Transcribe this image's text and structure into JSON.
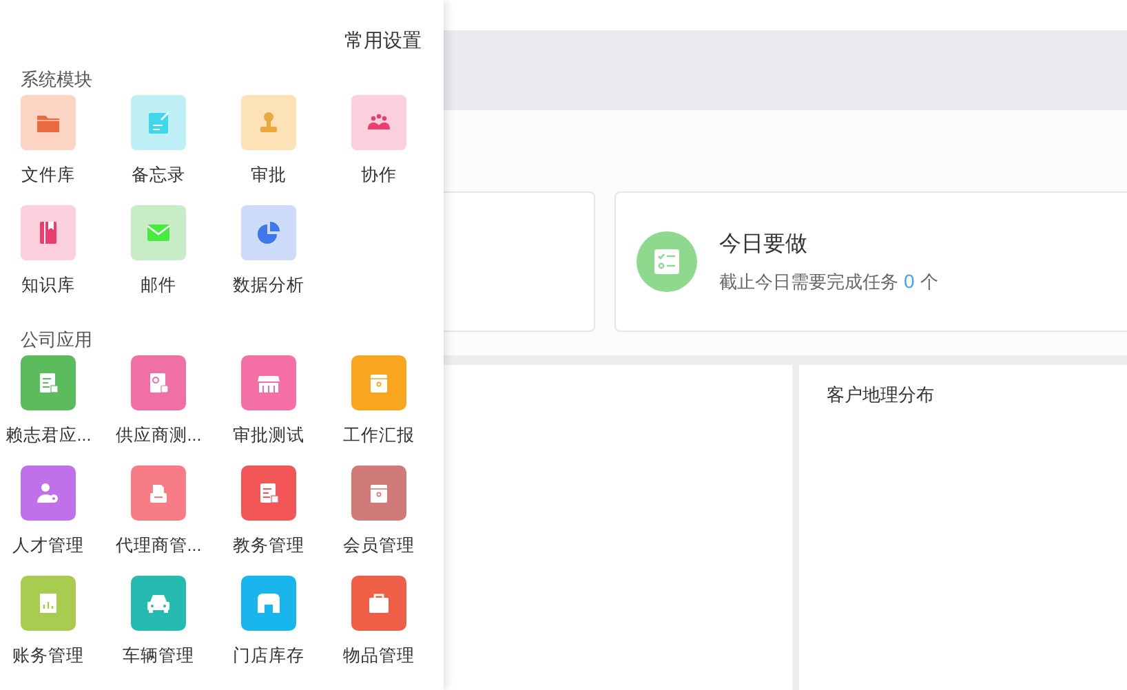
{
  "settings_link": "常用设置",
  "sections": [
    {
      "title": "系统模块",
      "apps": [
        {
          "label": "文件库",
          "kind": "folder",
          "color": "#fdd3c4"
        },
        {
          "label": "备忘录",
          "kind": "note",
          "color": "#bdeff5"
        },
        {
          "label": "审批",
          "kind": "stamp",
          "color": "#fde2b8"
        },
        {
          "label": "协作",
          "kind": "team",
          "color": "#fbd0dc"
        },
        {
          "label": "知识库",
          "kind": "book",
          "color": "#fbd0dc"
        },
        {
          "label": "邮件",
          "kind": "mail",
          "color": "#c8edc6"
        },
        {
          "label": "数据分析",
          "kind": "pie",
          "color": "#cddcfb"
        }
      ]
    },
    {
      "title": "公司应用",
      "apps": [
        {
          "label": "赖志君应...",
          "kind": "form",
          "color": "#5cbb5c"
        },
        {
          "label": "供应商测...",
          "kind": "gear-doc",
          "color": "#f06fa5"
        },
        {
          "label": "审批测试",
          "kind": "store",
          "color": "#f46fa5"
        },
        {
          "label": "工作汇报",
          "kind": "box",
          "color": "#f8a51f"
        },
        {
          "label": "人才管理",
          "kind": "user-gear",
          "color": "#c070e8"
        },
        {
          "label": "代理商管...",
          "kind": "printer",
          "color": "#f77c86"
        },
        {
          "label": "教务管理",
          "kind": "form",
          "color": "#f25656"
        },
        {
          "label": "会员管理",
          "kind": "box",
          "color": "#d17a7a"
        },
        {
          "label": "账务管理",
          "kind": "chart",
          "color": "#a8cc4f"
        },
        {
          "label": "车辆管理",
          "kind": "car",
          "color": "#26bbb0"
        },
        {
          "label": "门店库存",
          "kind": "shop",
          "color": "#18b6ec"
        },
        {
          "label": "物品管理",
          "kind": "bag",
          "color": "#ef5f48"
        }
      ]
    }
  ],
  "today_card": {
    "title": "今日要做",
    "subtitle_prefix": "截止今日需要完成任务",
    "count": "0",
    "subtitle_suffix": "个"
  },
  "map_panel": {
    "title": "客户地理分布"
  }
}
